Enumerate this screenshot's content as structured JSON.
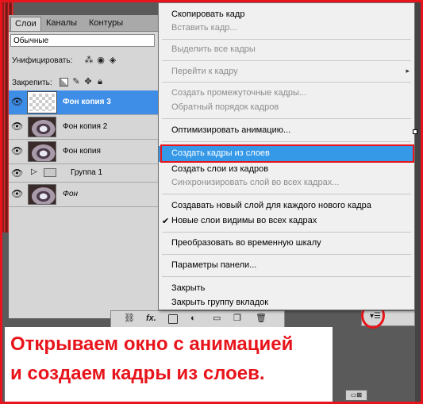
{
  "layers_panel": {
    "tabs": [
      "Слои",
      "Каналы",
      "Контуры"
    ],
    "blend_mode": "Обычные",
    "unify_label": "Унифицировать:",
    "lock_label": "Закрепить:",
    "layers": [
      {
        "name": "Фон копия 3",
        "selected": true,
        "thumb": "transparent"
      },
      {
        "name": "Фон копия 2",
        "selected": false,
        "thumb": "eye"
      },
      {
        "name": "Фон копия",
        "selected": false,
        "thumb": "eye"
      },
      {
        "name": "Группа 1",
        "selected": false,
        "thumb": "folder"
      },
      {
        "name": "Фон",
        "selected": false,
        "thumb": "eye",
        "italic": true
      }
    ],
    "bottom_icons": [
      "link-icon",
      "fx-icon",
      "mask-icon",
      "adjustment-icon",
      "group-icon",
      "new-layer-icon",
      "trash-icon"
    ],
    "fx_label": "fx."
  },
  "menu": {
    "items": [
      {
        "label": "Скопировать кадр",
        "disabled": false
      },
      {
        "label": "Вставить кадр...",
        "disabled": true
      },
      {
        "label": "Выделить все кадры",
        "disabled": true
      },
      {
        "label": "Перейти к кадру",
        "disabled": true,
        "submenu": true
      },
      {
        "label": "Создать промежуточные кадры...",
        "disabled": true
      },
      {
        "label": "Обратный порядок кадров",
        "disabled": true
      },
      {
        "label": "Оптимизировать анимацию...",
        "disabled": false
      },
      {
        "label": "Создать кадры из слоев",
        "disabled": false,
        "highlighted": true
      },
      {
        "label": "Создать слои из кадров",
        "disabled": false
      },
      {
        "label": "Синхронизировать слой во всех кадрах...",
        "disabled": true
      },
      {
        "label": "Создавать новый слой для каждого нового кадра",
        "disabled": false
      },
      {
        "label": "Новые слои видимы во всех кадрах",
        "disabled": false,
        "checked": true
      },
      {
        "label": "Преобразовать во временную шкалу",
        "disabled": false
      },
      {
        "label": "Параметры панели...",
        "disabled": false
      },
      {
        "label": "Закрыть",
        "disabled": false
      },
      {
        "label": "Закрыть группу вкладок",
        "disabled": false
      }
    ],
    "submenu_arrow": "▸",
    "check_mark": "✔"
  },
  "caption": {
    "line1": "Открываем окно с анимацией",
    "line2": "и создаем кадры из слоев."
  },
  "colors": {
    "accent_red": "#e8141b",
    "selection_blue": "#3599e8",
    "layer_selected": "#3e8ee8"
  }
}
